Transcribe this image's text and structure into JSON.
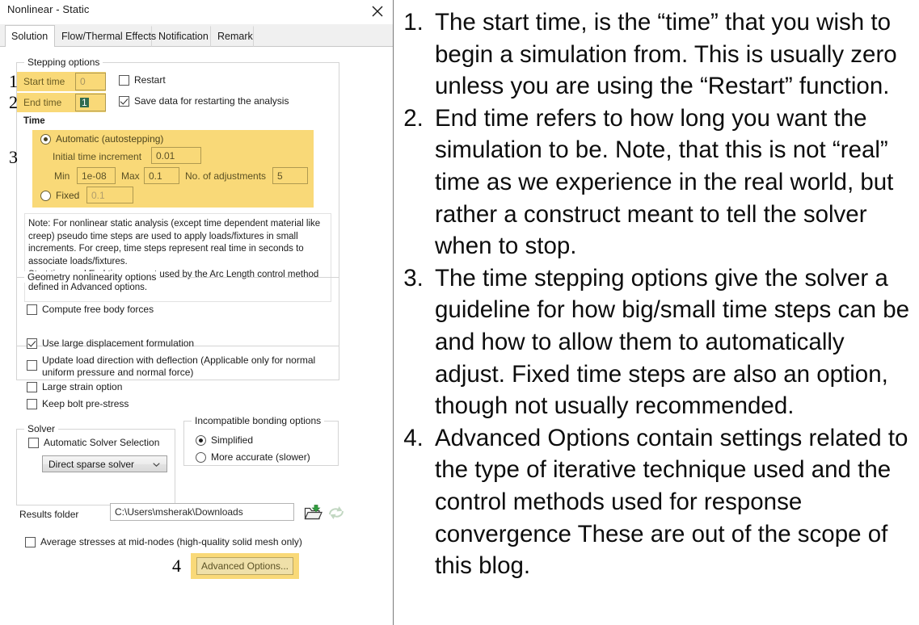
{
  "dialog": {
    "title": "Nonlinear - Static",
    "close_icon": "close-icon",
    "tabs": [
      {
        "label": "Solution",
        "selected": true
      },
      {
        "label": "Flow/Thermal Effects",
        "selected": false
      },
      {
        "label": "Notification",
        "selected": false
      },
      {
        "label": "Remark",
        "selected": false
      }
    ],
    "stepping_options": {
      "legend": "Stepping options",
      "start_time_label": "Start time",
      "start_time_value": "0",
      "end_time_label": "End time",
      "end_time_value": "1",
      "restart_label": "Restart",
      "restart_checked": false,
      "save_restart_label": "Save data for restarting the analysis",
      "save_restart_checked": true,
      "time_label": "Time",
      "automatic_label": "Automatic (autostepping)",
      "automatic_selected": true,
      "initial_increment_label": "Initial time increment",
      "initial_increment_value": "0.01",
      "min_label": "Min",
      "min_value": "1e-08",
      "max_label": "Max",
      "max_value": "0.1",
      "adjustments_label": "No. of adjustments",
      "adjustments_value": "5",
      "fixed_label": "Fixed",
      "fixed_selected": false,
      "fixed_value": "0.1",
      "note_paragraph_1": "Note: For nonlinear static analysis (except time dependent material like creep) pseudo time steps are used to apply loads/fixtures in small increments. For creep, time steps represent real time in seconds to associate loads/fixtures.",
      "note_paragraph_2": "Start time and End time  are not used by the Arc Length control method defined in Advanced options.",
      "compute_free_body_label": "Compute free body forces",
      "compute_free_body_checked": false
    },
    "geometry_nonlinearity": {
      "legend": "Geometry nonlinearity options",
      "items": [
        {
          "label": "Use large displacement formulation",
          "checked": true
        },
        {
          "label": "Update load direction with deflection (Applicable only for normal uniform pressure and normal force)",
          "checked": false
        },
        {
          "label": "Large strain option",
          "checked": false
        },
        {
          "label": "Keep bolt pre-stress",
          "checked": false
        }
      ]
    },
    "solver": {
      "legend": "Solver",
      "auto_select_label": "Automatic Solver Selection",
      "auto_select_checked": false,
      "selected_solver": "Direct sparse solver",
      "chevron_icon": "chevron-down-icon"
    },
    "incompatible_bonding": {
      "legend": "Incompatible bonding options",
      "options": [
        {
          "label": "Simplified",
          "selected": true
        },
        {
          "label": "More accurate (slower)",
          "selected": false
        }
      ]
    },
    "results": {
      "folder_label": "Results folder",
      "folder_value": "C:\\Users\\msherak\\Downloads",
      "browse_icon": "folder-open-icon",
      "refresh_icon": "refresh-icon"
    },
    "average_stresses_label": "Average stresses at mid-nodes (high-quality solid mesh only)",
    "average_stresses_checked": false,
    "advanced_options_label": "Advanced Options...",
    "annotations": [
      "1",
      "2",
      "3",
      "4"
    ],
    "highlight_color": "#f9d978",
    "selection_color": "#2f6b4f"
  },
  "notes": {
    "items": [
      "The start time, is the “time” that you wish to begin a simulation from. This is usually zero unless you are using the “Restart” function.",
      "End time refers to how long you want the simulation to be. Note, that this is not “real” time as we experience in the real world, but rather a construct meant to tell the solver when to stop.",
      "The time stepping options give the solver a guideline for how big/small time steps can be and how to allow them to automatically adjust. Fixed time steps are also an option, though not usually recommended.",
      "Advanced Options contain settings related to the type of iterative technique used and the control methods used for response convergence These are out of the scope of this blog."
    ]
  }
}
